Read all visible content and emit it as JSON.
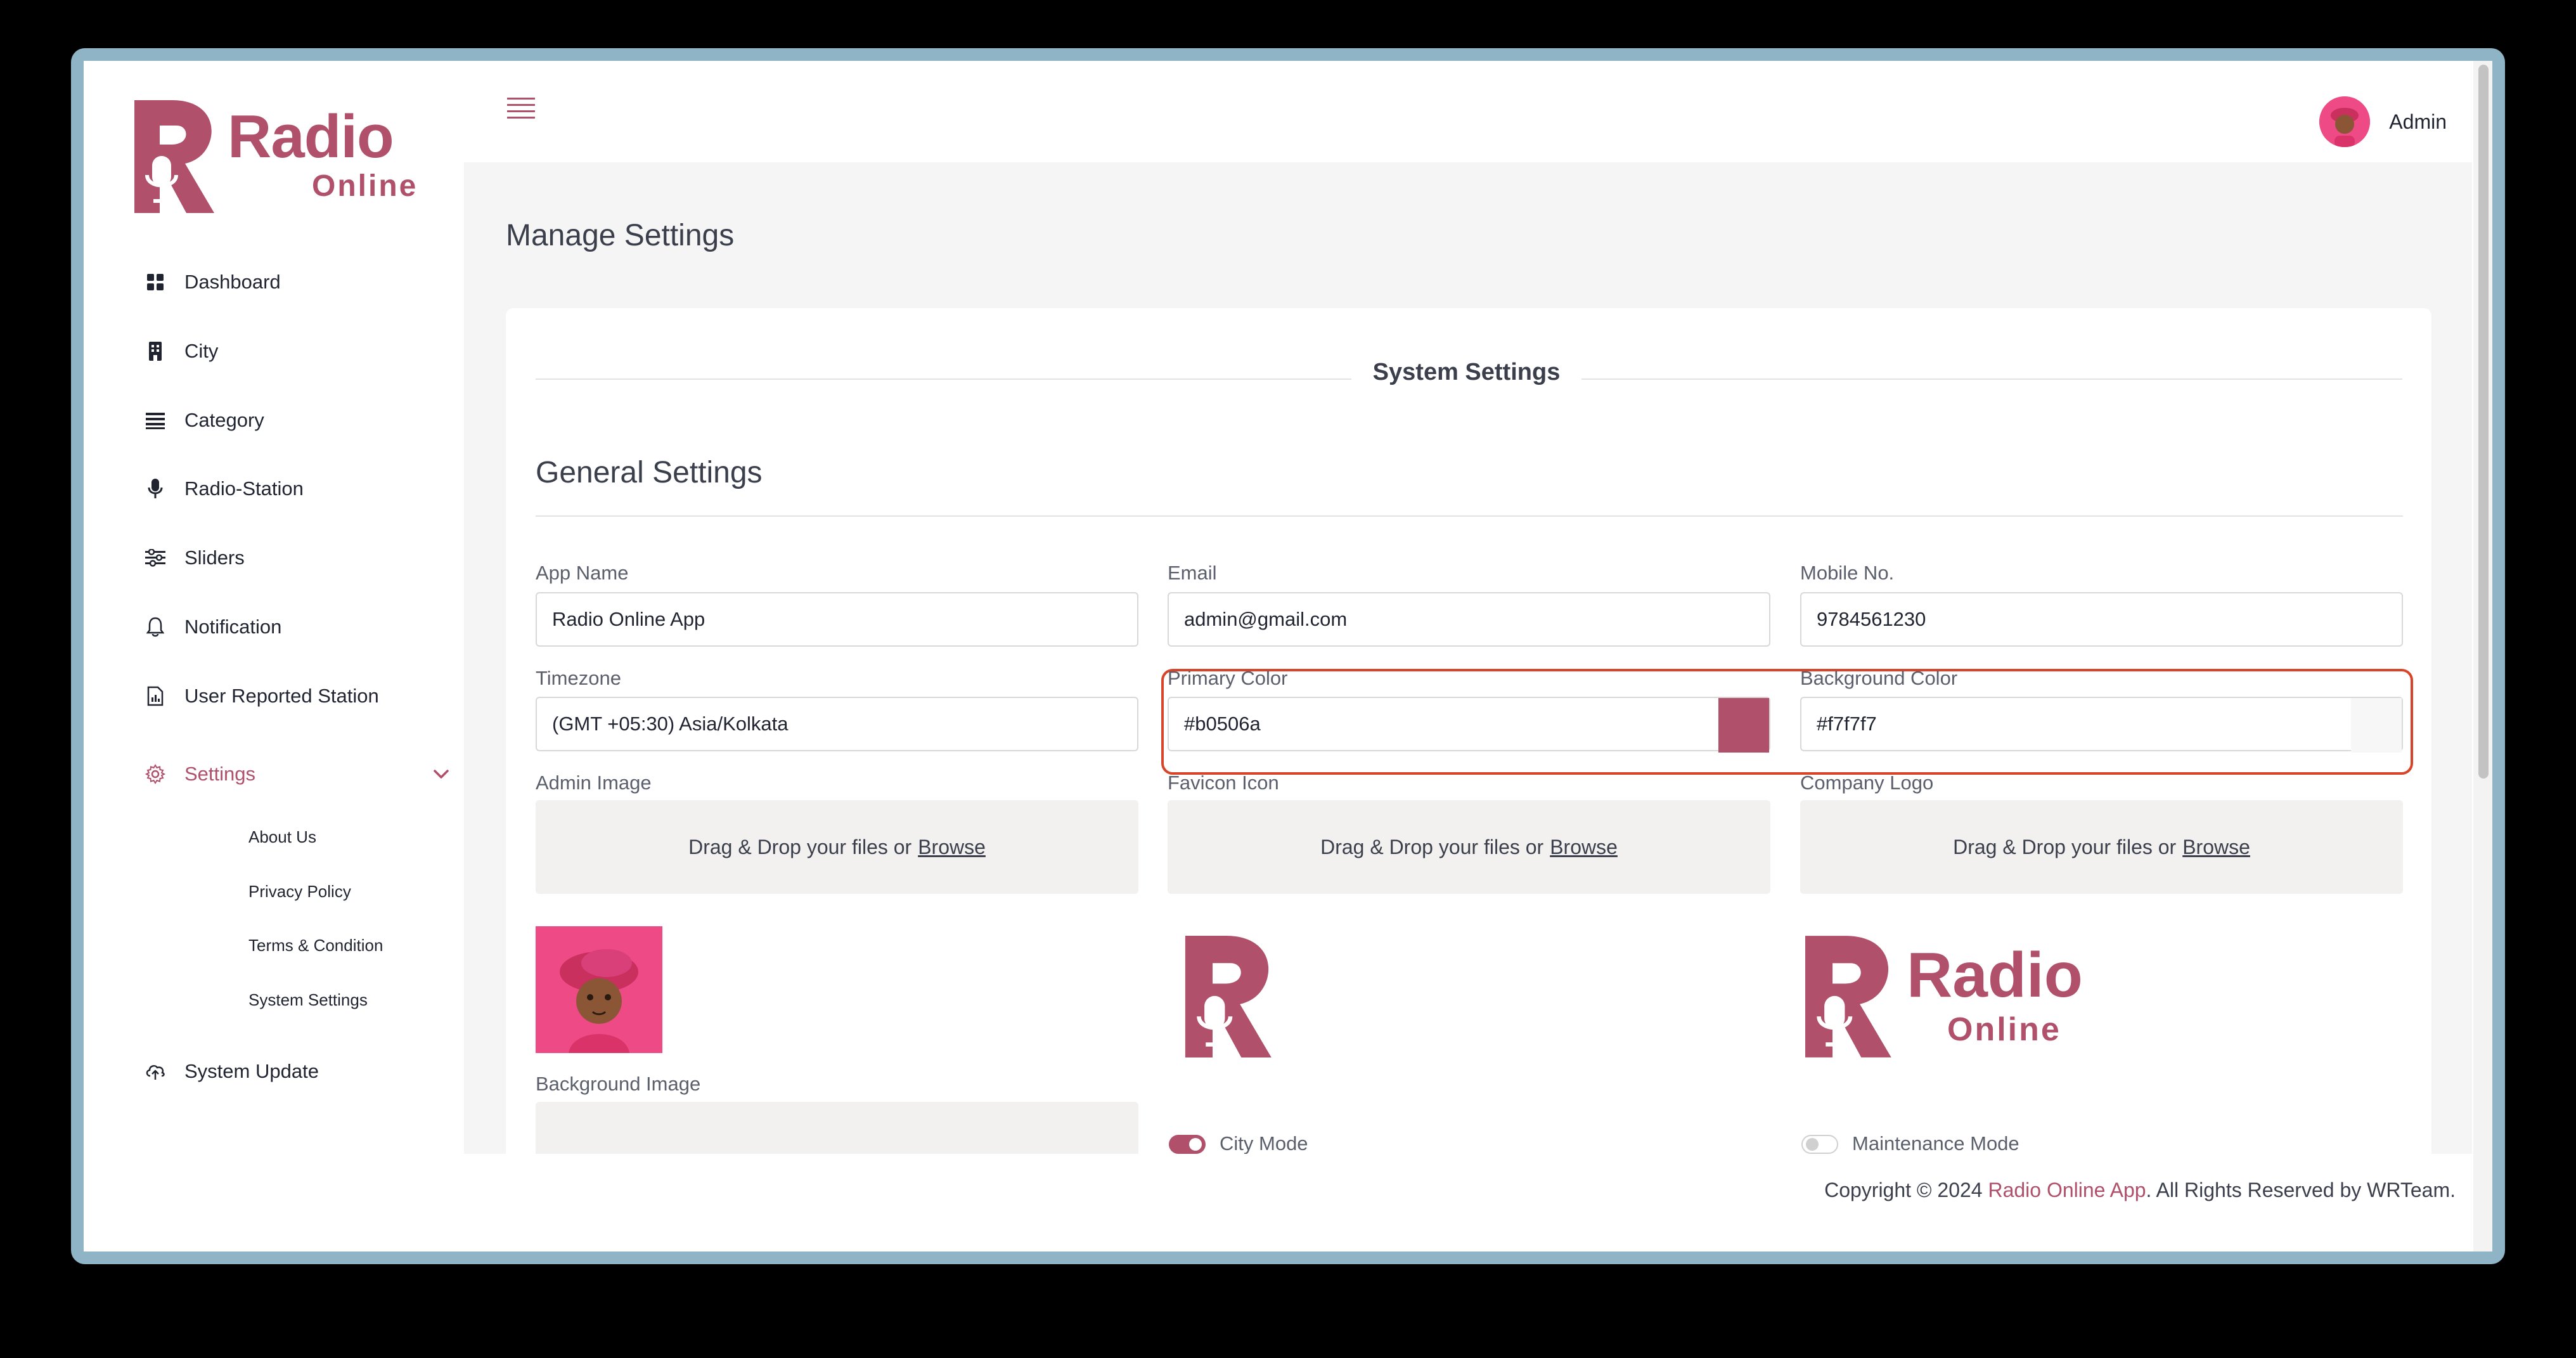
{
  "brand": {
    "name": "Radio",
    "sub": "Online",
    "color": "#b0506a"
  },
  "sidebar": {
    "items": [
      {
        "label": "Dashboard",
        "icon": "grid-icon"
      },
      {
        "label": "City",
        "icon": "building-icon"
      },
      {
        "label": "Category",
        "icon": "list-icon"
      },
      {
        "label": "Radio-Station",
        "icon": "microphone-icon"
      },
      {
        "label": "Sliders",
        "icon": "sliders-icon"
      },
      {
        "label": "Notification",
        "icon": "bell-icon"
      },
      {
        "label": "User Reported Station",
        "icon": "report-icon"
      }
    ],
    "settings": {
      "label": "Settings",
      "icon": "gear-icon",
      "children": [
        "About Us",
        "Privacy Policy",
        "Terms & Condition",
        "System Settings"
      ]
    },
    "system_update": {
      "label": "System Update",
      "icon": "cloud-upload-icon"
    }
  },
  "header": {
    "user": "Admin"
  },
  "page": {
    "title": "Manage Settings",
    "section_title": "System Settings",
    "group_title": "General Settings"
  },
  "form": {
    "app_name": {
      "label": "App Name",
      "value": "Radio Online App"
    },
    "email": {
      "label": "Email",
      "value": "admin@gmail.com"
    },
    "mobile": {
      "label": "Mobile No.",
      "value": "9784561230"
    },
    "timezone": {
      "label": "Timezone",
      "value": "(GMT +05:30) Asia/Kolkata"
    },
    "primary_color": {
      "label": "Primary Color",
      "value": "#b0506a"
    },
    "background_color": {
      "label": "Background Color",
      "value": "#f7f7f7"
    },
    "admin_image": {
      "label": "Admin Image"
    },
    "favicon_icon": {
      "label": "Favicon Icon"
    },
    "company_logo": {
      "label": "Company Logo"
    },
    "background_image": {
      "label": "Background Image"
    },
    "dropzone": {
      "text": "Drag & Drop your files or",
      "browse": "Browse"
    },
    "city_mode": {
      "label": "City Mode",
      "enabled": true
    },
    "maintenance_mode": {
      "label": "Maintenance Mode",
      "enabled": false
    }
  },
  "footer": {
    "prefix": "Copyright © 2024",
    "brand": "Radio Online App",
    "suffix": ". All Rights Reserved by WRTeam."
  }
}
